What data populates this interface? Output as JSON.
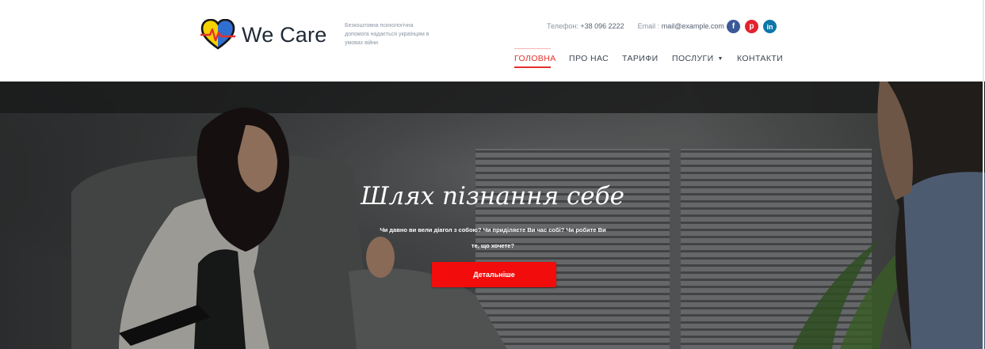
{
  "brand": {
    "name": "We Care",
    "tagline": "Безкоштовна психологічна допомога надається українцям в умовах війни"
  },
  "contact": {
    "phone_label": "Телефон:",
    "phone": "+38 096 2222",
    "email_label": "Email :",
    "email": "mail@example.com"
  },
  "socials": [
    {
      "icon": "facebook-icon",
      "glyph": "f",
      "color": "#3b5998"
    },
    {
      "icon": "pinterest-icon",
      "glyph": "p",
      "color": "#e0242f"
    },
    {
      "icon": "linkedin-icon",
      "glyph": "in",
      "color": "#0e76a8"
    }
  ],
  "nav": {
    "items": [
      {
        "label": "ГОЛОВНА",
        "active": true
      },
      {
        "label": "ПРО НАС",
        "active": false
      },
      {
        "label": "ТАРИФИ",
        "active": false
      },
      {
        "label": "ПОСЛУГИ",
        "active": false,
        "dropdown": true
      },
      {
        "label": "КОНТАКТИ",
        "active": false
      }
    ]
  },
  "hero": {
    "title": "Шлях пізнання себе",
    "subtitle": "Чи давно ви вели діагол з собою? Чи приділяєте Ви час собі? Чи робите Ви те, що хочете?",
    "button_label": "Детальніше"
  },
  "colors": {
    "accent": "#e5312c",
    "button": "#f20c0c",
    "text_dark": "#1f2a36"
  }
}
